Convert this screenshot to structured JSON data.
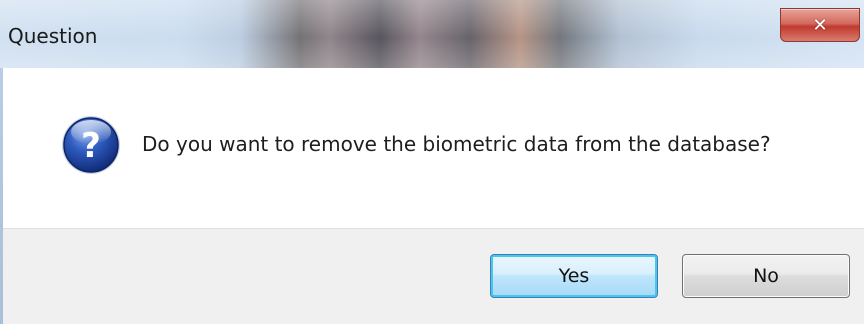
{
  "dialog": {
    "title": "Question",
    "message": "Do you want to remove the biometric data from the database?",
    "icon": "question-icon",
    "close_icon": "close-icon"
  },
  "buttons": {
    "yes_label": "Yes",
    "no_label": "No",
    "default": "Yes"
  },
  "colors": {
    "close_button": "#c0392e",
    "default_button_border": "#3c7fb1",
    "button_area_bg": "#f0f0f0",
    "question_icon": "#2a4fa8"
  }
}
